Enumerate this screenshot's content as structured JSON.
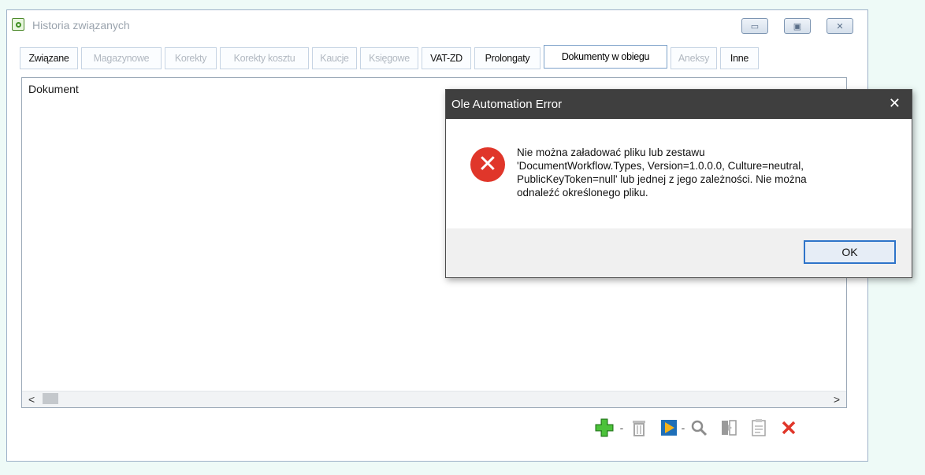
{
  "window": {
    "title": "Historia związanych",
    "controls": [
      "minimize",
      "maximize",
      "close"
    ]
  },
  "tabs": [
    {
      "label": "Związane",
      "state": "enabled"
    },
    {
      "label": "Magazynowe",
      "state": "disabled"
    },
    {
      "label": "Korekty",
      "state": "disabled"
    },
    {
      "label": "Korekty kosztu",
      "state": "disabled"
    },
    {
      "label": "Kaucje",
      "state": "disabled"
    },
    {
      "label": "Księgowe",
      "state": "disabled"
    },
    {
      "label": "VAT-ZD",
      "state": "enabled"
    },
    {
      "label": "Prolongaty",
      "state": "enabled"
    },
    {
      "label": "Dokumenty w obiegu",
      "state": "active"
    },
    {
      "label": "Aneksy",
      "state": "disabled"
    },
    {
      "label": "Inne",
      "state": "enabled"
    }
  ],
  "list": {
    "column_header": "Dokument",
    "scroll_left": "<",
    "scroll_right": ">"
  },
  "toolbar": {
    "icons": [
      "add-icon",
      "trash-icon",
      "play-icon",
      "search-icon",
      "transfer-icon",
      "clipboard-icon",
      "delete-icon"
    ],
    "separators": [
      "-",
      "-"
    ]
  },
  "dialog": {
    "title": "Ole Automation Error",
    "close_glyph": "✕",
    "message": "Nie można załadować pliku lub zestawu\n'DocumentWorkflow.Types, Version=1.0.0.0, Culture=neutral,\nPublicKeyToken=null' lub jednej z jego zależności. Nie można\nodnaleźć określonego pliku.",
    "ok_label": "OK",
    "icon": "error-icon"
  },
  "colors": {
    "error_red": "#e0362a",
    "dialog_titlebar": "#3f3f3f",
    "ok_border": "#2e74c9",
    "add_green": "#3daa2e",
    "delete_red": "#e0362a"
  }
}
